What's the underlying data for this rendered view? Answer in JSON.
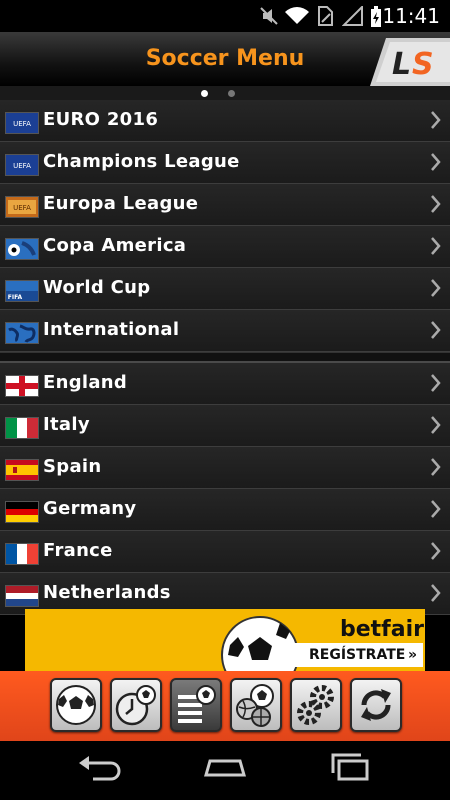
{
  "status_bar": {
    "time": "11:41",
    "icons": [
      "mute-icon",
      "wifi-icon",
      "sim-icon",
      "signal-icon",
      "battery-icon"
    ]
  },
  "header": {
    "title": "Soccer Menu",
    "logo_text": "LS"
  },
  "competitions": [
    {
      "label": "EURO 2016",
      "icon": "uefa-icon"
    },
    {
      "label": "Champions League",
      "icon": "uefa-icon"
    },
    {
      "label": "Europa League",
      "icon": "uefa-europa-icon"
    },
    {
      "label": "Copa America",
      "icon": "copa-america-icon"
    },
    {
      "label": "World Cup",
      "icon": "fifa-icon"
    },
    {
      "label": "International",
      "icon": "globe-icon"
    }
  ],
  "countries": [
    {
      "label": "England",
      "icon": "flag-england"
    },
    {
      "label": "Italy",
      "icon": "flag-italy"
    },
    {
      "label": "Spain",
      "icon": "flag-spain"
    },
    {
      "label": "Germany",
      "icon": "flag-germany"
    },
    {
      "label": "France",
      "icon": "flag-france"
    },
    {
      "label": "Netherlands",
      "icon": "flag-netherlands"
    }
  ],
  "ad": {
    "brand": "betfair",
    "cta": "REGÍSTRATE"
  },
  "toolbar": [
    "soccer-ball-icon",
    "live-clock-icon",
    "menu-list-icon",
    "multi-sport-icon",
    "settings-icon",
    "refresh-icon"
  ],
  "colors": {
    "accent": "#f7941d",
    "toolbar": "#ff5a1f",
    "ad_bg": "#f5b800"
  }
}
